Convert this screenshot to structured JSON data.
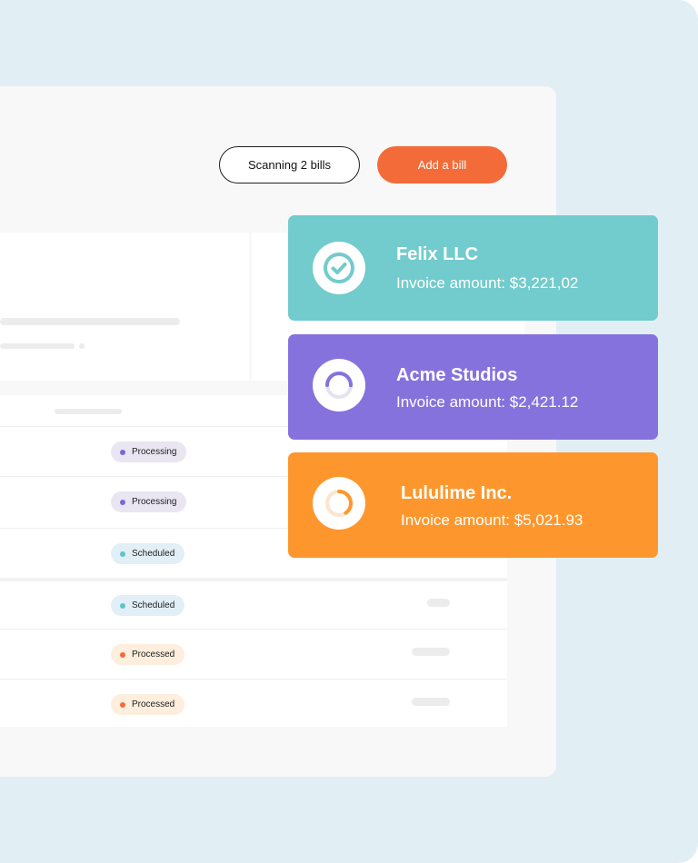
{
  "header": {
    "scanning_label": "Scanning 2 bills",
    "add_bill_label": "Add a bill"
  },
  "rows": [
    {
      "status": "Processing",
      "kind": "processing"
    },
    {
      "status": "Processing",
      "kind": "processing"
    },
    {
      "status": "Scheduled",
      "kind": "scheduled"
    },
    {
      "status": "Scheduled",
      "kind": "scheduled"
    },
    {
      "status": "Processed",
      "kind": "processed"
    },
    {
      "status": "Processed",
      "kind": "processed"
    }
  ],
  "cards": [
    {
      "vendor": "Felix LLC",
      "amount": "Invoice amount: $3,221,02",
      "color": "#72cbcc",
      "icon": "check-circle-icon",
      "progress": 1.0
    },
    {
      "vendor": "Acme Studios",
      "amount": "Invoice amount: $2,421.12",
      "color": "#8672dd",
      "icon": "progress-ring-icon",
      "progress": 0.5
    },
    {
      "vendor": "Lululime Inc.",
      "amount": "Invoice amount: $5,021.93",
      "color": "#fd972d",
      "icon": "progress-ring-icon",
      "progress": 0.4
    }
  ]
}
